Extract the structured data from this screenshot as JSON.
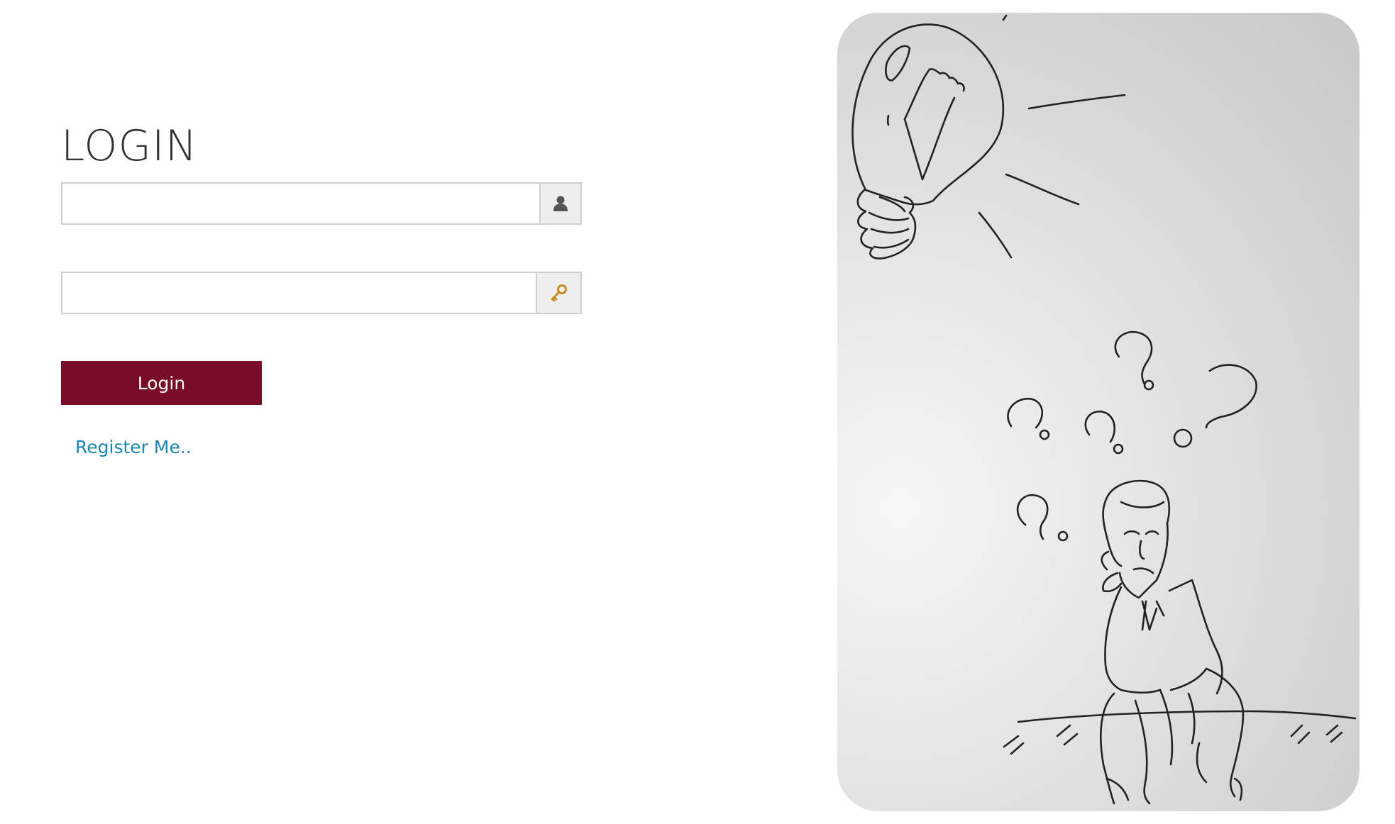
{
  "form": {
    "title": "LOGIN",
    "username": {
      "value": "",
      "placeholder": "",
      "icon": "user-icon"
    },
    "password": {
      "value": "",
      "placeholder": "",
      "icon": "key-icon"
    },
    "submit_label": "Login",
    "register_label": "Register Me.."
  },
  "colors": {
    "button_bg": "#7a0d26",
    "link": "#1a86b8",
    "input_border": "#cfcfcf",
    "addon_bg": "#eeeeee"
  },
  "illustration": {
    "description_icon": "thinking-man-lightbulb-illustration"
  }
}
